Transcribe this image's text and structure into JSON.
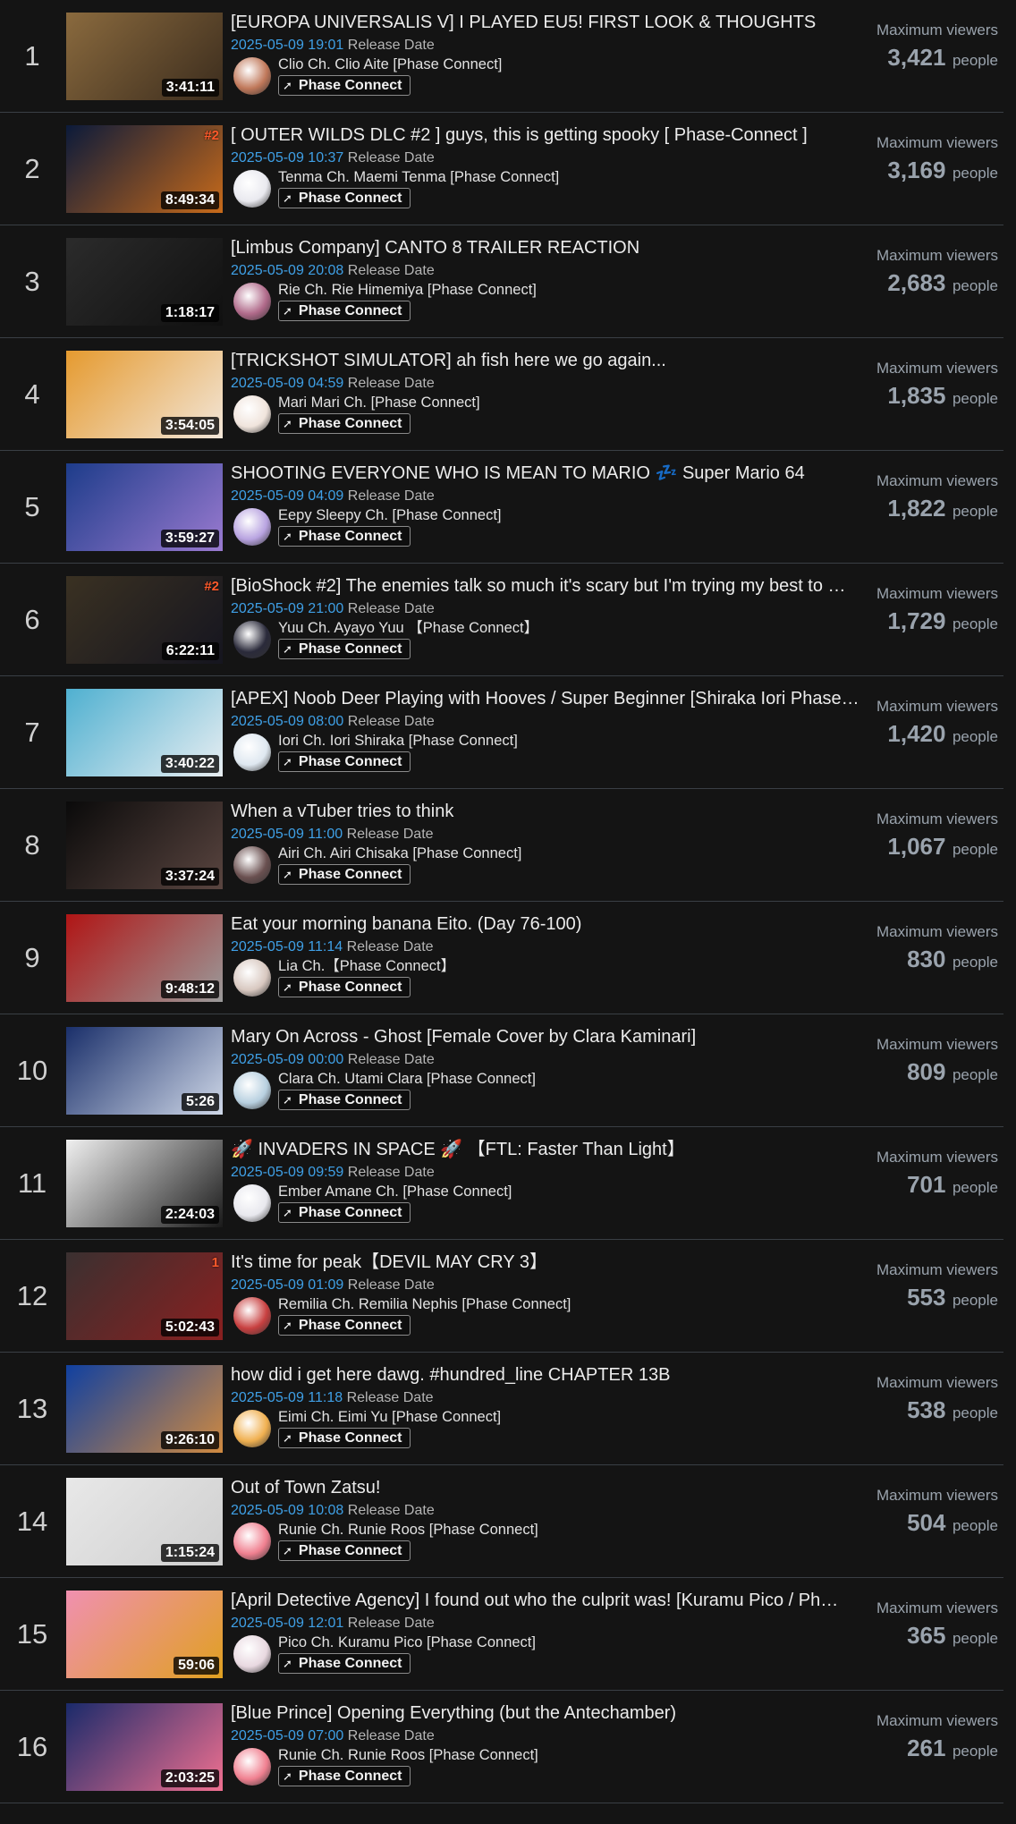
{
  "labels": {
    "release_date": "Release Date",
    "viewers_label": "Maximum viewers",
    "viewers_unit": "people",
    "group_tag": "Phase Connect"
  },
  "streams": [
    {
      "rank": "1",
      "title": "[EUROPA UNIVERSALIS V] I PLAYED EU5! FIRST LOOK & THOUGHTS",
      "date": "2025-05-09 19:01",
      "channel": "Clio Ch. Clio Aite [Phase Connect]",
      "duration": "3:41:11",
      "viewers": "3,421",
      "thumb": [
        "#8a6a3e",
        "#3b2c1d"
      ],
      "avatar": "#c0785a"
    },
    {
      "rank": "2",
      "title": "[ OUTER WILDS DLC #2 ] guys, this is getting spooky [ Phase-Connect ]",
      "date": "2025-05-09 10:37",
      "channel": "Tenma Ch. Maemi Tenma [Phase Connect]",
      "duration": "8:49:34",
      "viewers": "3,169",
      "badge": "#2",
      "thumb": [
        "#0b1a3a",
        "#c76a1a"
      ],
      "avatar": "#e9e9ef"
    },
    {
      "rank": "3",
      "title": "[Limbus Company] CANTO 8 TRAILER REACTION",
      "date": "2025-05-09 20:08",
      "channel": "Rie Ch. Rie Himemiya [Phase Connect]",
      "duration": "1:18:17",
      "viewers": "2,683",
      "thumb": [
        "#2b2b2b",
        "#101010"
      ],
      "avatar": "#b06a8a"
    },
    {
      "rank": "4",
      "title": "[TRICKSHOT SIMULATOR] ah fish here we go again...",
      "date": "2025-05-09 04:59",
      "channel": "Mari Mari Ch. [Phase Connect]",
      "duration": "3:54:05",
      "viewers": "1,835",
      "thumb": [
        "#e59a2f",
        "#f2e6d8"
      ],
      "avatar": "#f0e4dc"
    },
    {
      "rank": "5",
      "title": "SHOOTING EVERYONE WHO IS MEAN TO MARIO 💤 Super Mario 64",
      "date": "2025-05-09 04:09",
      "channel": "Eepy Sleepy Ch. [Phase Connect]",
      "duration": "3:59:27",
      "viewers": "1,822",
      "thumb": [
        "#1d3c8a",
        "#9a7ad0"
      ],
      "avatar": "#b8a3e0"
    },
    {
      "rank": "6",
      "title": "[BioShock #2] The enemies talk so much it's scary but I'm trying my best to …",
      "date": "2025-05-09 21:00",
      "channel": "Yuu Ch. Ayayo Yuu 【Phase Connect】",
      "duration": "6:22:11",
      "viewers": "1,729",
      "badge": "#2",
      "thumb": [
        "#3a3122",
        "#15151f"
      ],
      "avatar": "#2a2a3a"
    },
    {
      "rank": "7",
      "title": "[APEX] Noob Deer Playing with Hooves / Super Beginner [Shiraka Iori Phase…",
      "date": "2025-05-09 08:00",
      "channel": "Iori Ch. Iori Shiraka [Phase Connect]",
      "duration": "3:40:22",
      "viewers": "1,420",
      "thumb": [
        "#4fb0d0",
        "#e8eef2"
      ],
      "avatar": "#dfe8f0"
    },
    {
      "rank": "8",
      "title": "When a vTuber tries to think",
      "date": "2025-05-09 11:00",
      "channel": "Airi Ch. Airi Chisaka [Phase Connect]",
      "duration": "3:37:24",
      "viewers": "1,067",
      "thumb": [
        "#0a0a0a",
        "#5a4540"
      ],
      "avatar": "#6a5050"
    },
    {
      "rank": "9",
      "title": "Eat your morning banana Eito. (Day 76-100)",
      "date": "2025-05-09 11:14",
      "channel": "Lia Ch.【Phase Connect】",
      "duration": "9:48:12",
      "viewers": "830",
      "thumb": [
        "#b01515",
        "#9a9a9a"
      ],
      "avatar": "#d8c8c0"
    },
    {
      "rank": "10",
      "title": "Mary On Across - Ghost [Female Cover by Clara Kaminari]",
      "date": "2025-05-09 00:00",
      "channel": "Clara Ch. Utami Clara [Phase Connect]",
      "duration": "5:26",
      "viewers": "809",
      "thumb": [
        "#1a2f6a",
        "#cfd8e8"
      ],
      "avatar": "#b8d0e0"
    },
    {
      "rank": "11",
      "title": "🚀 INVADERS IN SPACE 🚀 【FTL: Faster Than Light】",
      "date": "2025-05-09 09:59",
      "channel": "Ember Amane Ch. [Phase Connect]",
      "duration": "2:24:03",
      "viewers": "701",
      "thumb": [
        "#f0f0f0",
        "#1a1a1a"
      ],
      "avatar": "#e8e8ee"
    },
    {
      "rank": "12",
      "title": "It's time for peak【DEVIL MAY CRY 3】",
      "date": "2025-05-09 01:09",
      "channel": "Remilia Ch. Remilia Nephis [Phase Connect]",
      "duration": "5:02:43",
      "viewers": "553",
      "badge": "1",
      "thumb": [
        "#3a3030",
        "#8a2020"
      ],
      "avatar": "#c84040"
    },
    {
      "rank": "13",
      "title": "how did i get here dawg. #hundred_line CHAPTER 13B",
      "date": "2025-05-09 11:18",
      "channel": "Eimi Ch. Eimi Yu [Phase Connect]",
      "duration": "9:26:10",
      "viewers": "538",
      "thumb": [
        "#1040a0",
        "#d08a40"
      ],
      "avatar": "#f0b050"
    },
    {
      "rank": "14",
      "title": "Out of Town Zatsu!",
      "date": "2025-05-09 10:08",
      "channel": "Runie Ch. Runie Roos [Phase Connect]",
      "duration": "1:15:24",
      "viewers": "504",
      "thumb": [
        "#e8e8e8",
        "#cfcfcf"
      ],
      "avatar": "#f08090"
    },
    {
      "rank": "15",
      "title": "[April Detective Agency] I found out who the culprit was! [Kuramu Pico / Ph…",
      "date": "2025-05-09 12:01",
      "channel": "Pico Ch. Kuramu Pico [Phase Connect]",
      "duration": "59:06",
      "viewers": "365",
      "thumb": [
        "#f090b0",
        "#e0a020"
      ],
      "avatar": "#e8d8e0"
    },
    {
      "rank": "16",
      "title": "[Blue Prince] Opening Everything (but the Antechamber)",
      "date": "2025-05-09 07:00",
      "channel": "Runie Ch. Runie Roos [Phase Connect]",
      "duration": "2:03:25",
      "viewers": "261",
      "thumb": [
        "#1a2a6a",
        "#f07090"
      ],
      "avatar": "#f08090"
    }
  ]
}
